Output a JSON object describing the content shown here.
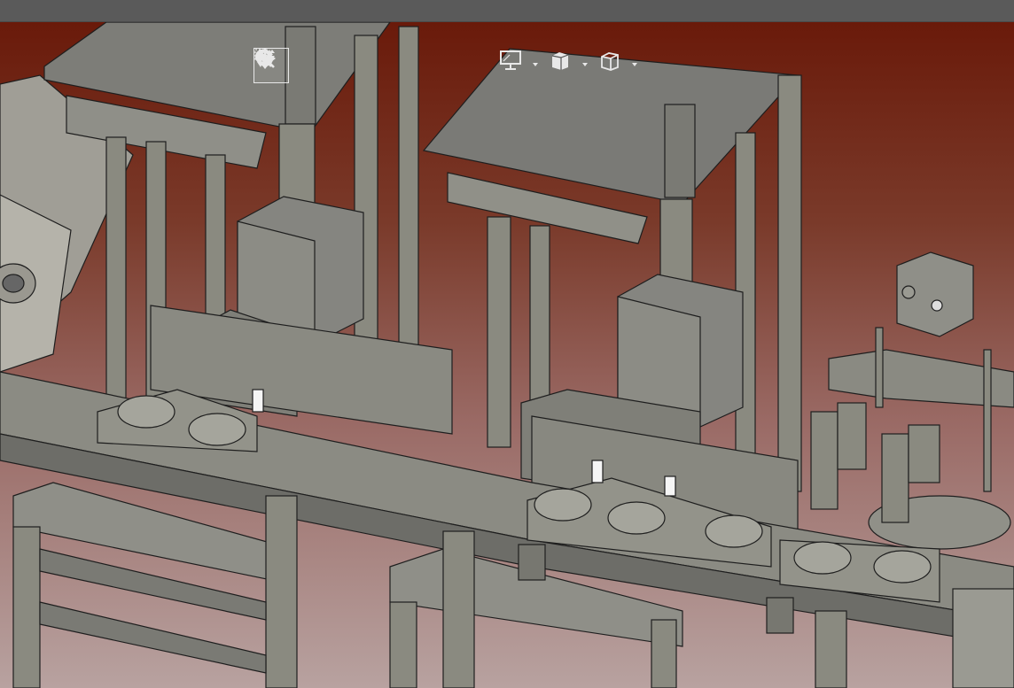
{
  "window": {
    "title_bar_color": "#5a5a5a"
  },
  "viewport": {
    "background_top": "#6a1a0a",
    "background_bottom": "#b8a2a0",
    "model_fill": "#8a8a80",
    "model_edge": "#1e1e1e"
  },
  "toolbar": {
    "buttons": [
      {
        "name": "select-tool-button",
        "icon": "cursor-arrow-icon",
        "active": true,
        "dropdown": false
      },
      {
        "name": "pan-tool-button",
        "icon": "move-arrows-icon",
        "active": false,
        "dropdown": false
      },
      {
        "name": "rotate-tool-button",
        "icon": "rotate-icon",
        "active": false,
        "dropdown": false
      },
      {
        "name": "zoom-tool-button",
        "icon": "zoom-updown-icon",
        "active": false,
        "dropdown": false
      },
      {
        "name": "zoom-window-button",
        "icon": "zoom-window-icon",
        "active": false,
        "dropdown": false
      },
      {
        "name": "zoom-fit-button",
        "icon": "zoom-fit-icon",
        "active": false,
        "dropdown": false
      },
      {
        "name": "display-mode-button",
        "icon": "monitor-icon",
        "active": false,
        "dropdown": true
      },
      {
        "name": "section-view-button",
        "icon": "section-cube-icon",
        "active": false,
        "dropdown": true
      },
      {
        "name": "view-orientation-button",
        "icon": "cube-icon",
        "active": false,
        "dropdown": true
      }
    ],
    "icon_color": "#e8e8e8"
  }
}
